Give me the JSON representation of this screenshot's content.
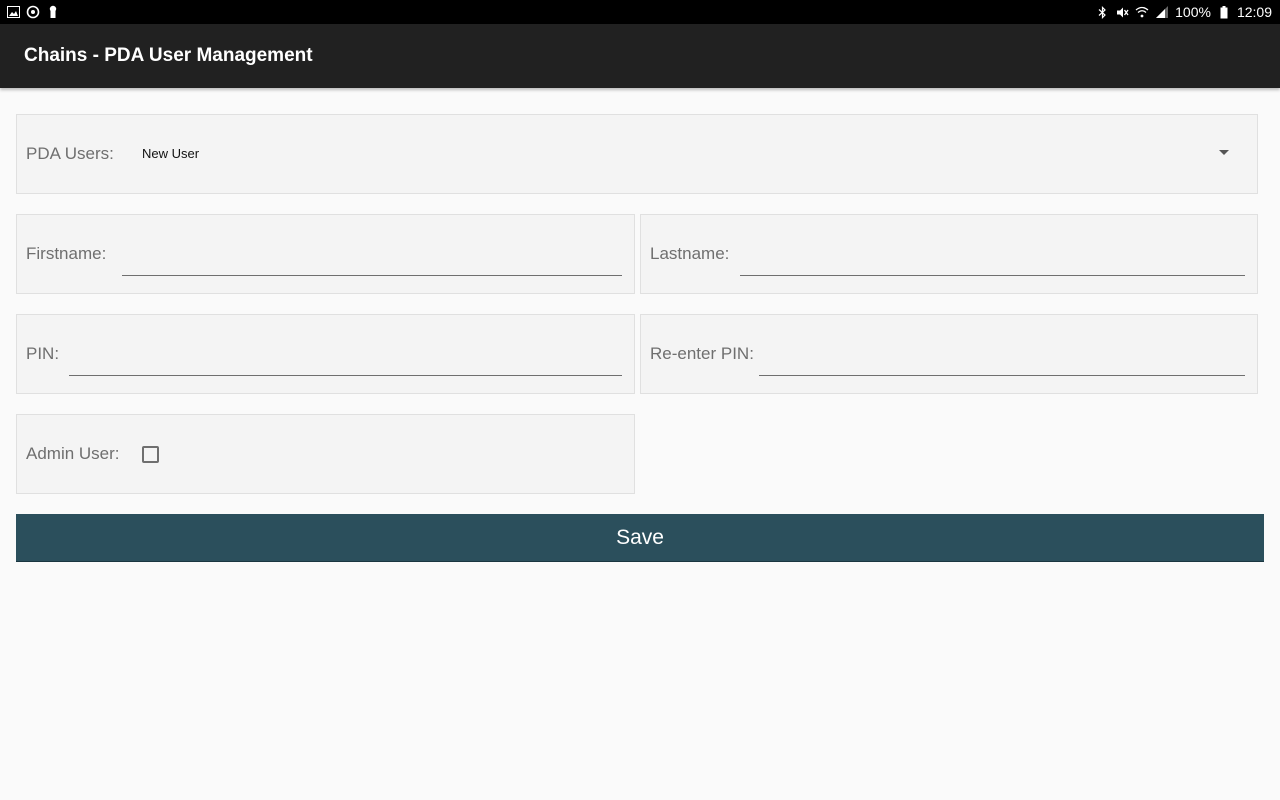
{
  "status_bar": {
    "left_icons": [
      "image-icon",
      "sync-icon",
      "keyhole-icon"
    ],
    "right_icons": [
      "bluetooth-icon",
      "mute-icon",
      "wifi-icon",
      "signal-icon",
      "battery-icon"
    ],
    "battery": "100%",
    "time": "12:09"
  },
  "app_bar": {
    "title": "Chains - PDA User Management"
  },
  "form": {
    "pda_users": {
      "label": "PDA Users:",
      "selected": "New User"
    },
    "firstname": {
      "label": "Firstname:",
      "value": ""
    },
    "lastname": {
      "label": "Lastname:",
      "value": ""
    },
    "pin": {
      "label": "PIN:",
      "value": ""
    },
    "reenter_pin": {
      "label": "Re-enter PIN:",
      "value": ""
    },
    "admin_user": {
      "label": "Admin User:",
      "checked": false
    },
    "save_label": "Save"
  },
  "colors": {
    "status_bar_bg": "#000000",
    "app_bar_bg": "#212121",
    "panel_bg": "#f4f4f4",
    "save_button_bg": "#2b4f5c"
  }
}
